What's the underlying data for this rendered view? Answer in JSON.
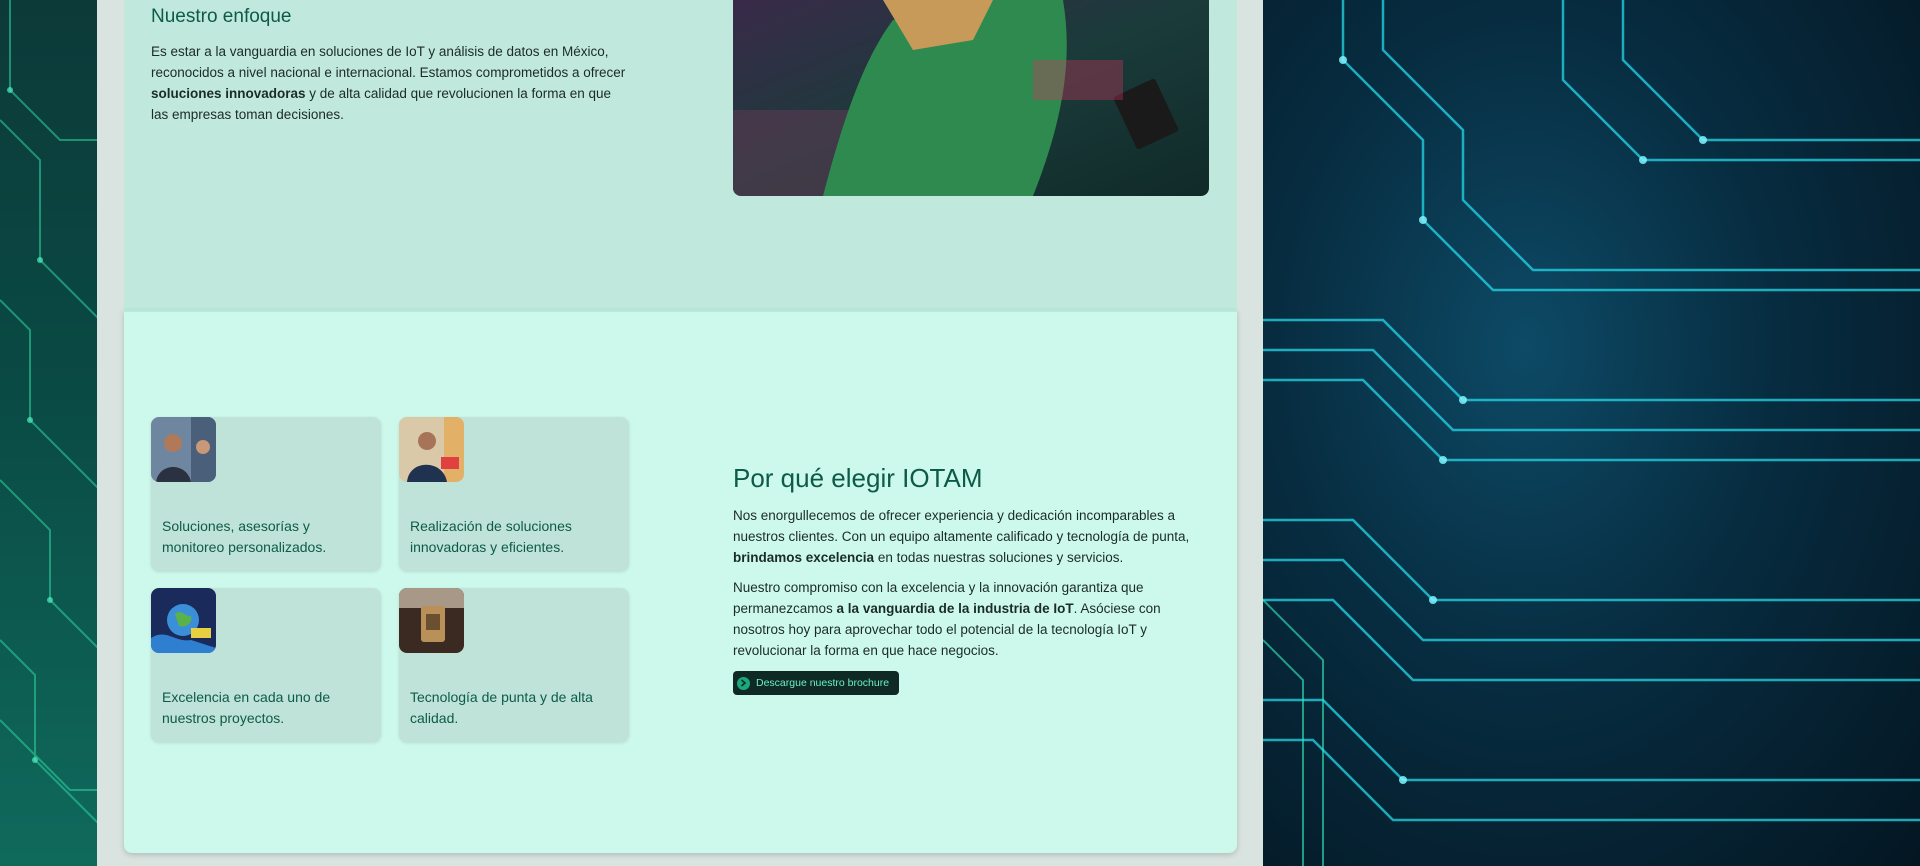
{
  "enfoque": {
    "title": "Nuestro enfoque",
    "text_1": "Es estar a la vanguardia en soluciones de IoT y análisis de datos en México, reconocidos a nivel nacional e internacional. Estamos comprometidos a ofrecer ",
    "text_bold": "soluciones innovadoras",
    "text_2": " y de alta calidad que revolucionen la forma en que las empresas toman decisiones."
  },
  "cards": [
    {
      "label": "Soluciones, asesorías y monitoreo personalizados.",
      "icon": "people-photo"
    },
    {
      "label": "Realización de soluciones innovadoras y eficientes.",
      "icon": "engineer-photo"
    },
    {
      "label": "Excelencia en cada uno de nuestros proyectos.",
      "icon": "globe-hands-photo"
    },
    {
      "label": "Tecnología de punta y de alta calidad.",
      "icon": "device-photo"
    }
  ],
  "why": {
    "title": "Por qué elegir IOTAM",
    "p1_a": "Nos enorgullecemos de ofrecer experiencia y dedicación incomparables a nuestros clientes. Con un equipo altamente calificado y tecnología de punta, ",
    "p1_bold": "brindamos excelencia",
    "p1_b": " en todas nuestras soluciones y servicios.",
    "p2_a": "Nuestro compromiso con la excelencia y la innovación garantiza que permanezcamos ",
    "p2_bold": "a la vanguardia de la industria de IoT",
    "p2_b": ". Asóciese con nosotros hoy para aprovechar todo el potencial de la tecnología IoT y revolucionar la forma en que hace negocios.",
    "button_label": "Descargue nuestro brochure"
  },
  "colors": {
    "accent": "#0d5b47",
    "button_bg": "#0f2a25",
    "button_text": "#69f0c8"
  }
}
